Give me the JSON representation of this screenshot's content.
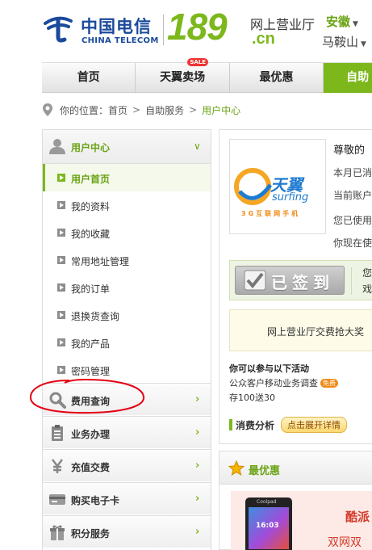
{
  "header": {
    "brand_cn": "中国电信",
    "brand_en": "CHINA TELECOM",
    "number": "189",
    "domain": ".cn",
    "hall_title": "网上营业厅",
    "province": "安徽",
    "city": "马鞍山"
  },
  "nav": {
    "items": [
      {
        "label": "首页"
      },
      {
        "label": "天翼卖场",
        "badge": "SALE"
      },
      {
        "label": "最优惠"
      },
      {
        "label": "自助"
      }
    ]
  },
  "breadcrumb": {
    "prefix": "你的位置：",
    "items": [
      "首页",
      "自助服务",
      "用户中心"
    ],
    "separator": ">"
  },
  "sidebar": {
    "header": "用户中心",
    "sub_items": [
      {
        "label": "用户首页",
        "active": true
      },
      {
        "label": "我的资料"
      },
      {
        "label": "我的收藏"
      },
      {
        "label": "常用地址管理"
      },
      {
        "label": "我的订单"
      },
      {
        "label": "退换货查询"
      },
      {
        "label": "我的产品"
      },
      {
        "label": "密码管理"
      }
    ],
    "sections": [
      {
        "label": "费用查询",
        "icon": "magnifier-icon"
      },
      {
        "label": "业务办理",
        "icon": "clipboard-icon"
      },
      {
        "label": "充值交费",
        "icon": "yuan-icon"
      },
      {
        "label": "购买电子卡",
        "icon": "card-icon"
      },
      {
        "label": "积分服务",
        "icon": "gift-icon"
      }
    ]
  },
  "main": {
    "product": {
      "name_cn": "天翼",
      "name_en": "surfing",
      "tagline": "3G互联网手机"
    },
    "greeting": "尊敬的",
    "lines": [
      "本月已消",
      "当前账户",
      "您已使用",
      "你现在使"
    ],
    "sign_in": {
      "label": "已签到",
      "side_top": "您",
      "side_bottom": "戏"
    },
    "promo_text": "网上营业厅交费抢大奖",
    "activity": {
      "title": "你可以参与以下活动",
      "item": "公众客户移动业务调查",
      "badge": "免费",
      "points": "存100送30"
    },
    "consumption": {
      "title": "消费分析",
      "button": "点击展开详情"
    }
  },
  "best": {
    "title": "最优惠",
    "banner_brand": "Coolpad",
    "banner_time": "16:03",
    "banner_title": "酷派",
    "banner_sub": "双网双待"
  },
  "colors": {
    "brand_green": "#7cb81c",
    "brand_blue": "#1a4a9c",
    "annotation_red": "#e60012"
  }
}
